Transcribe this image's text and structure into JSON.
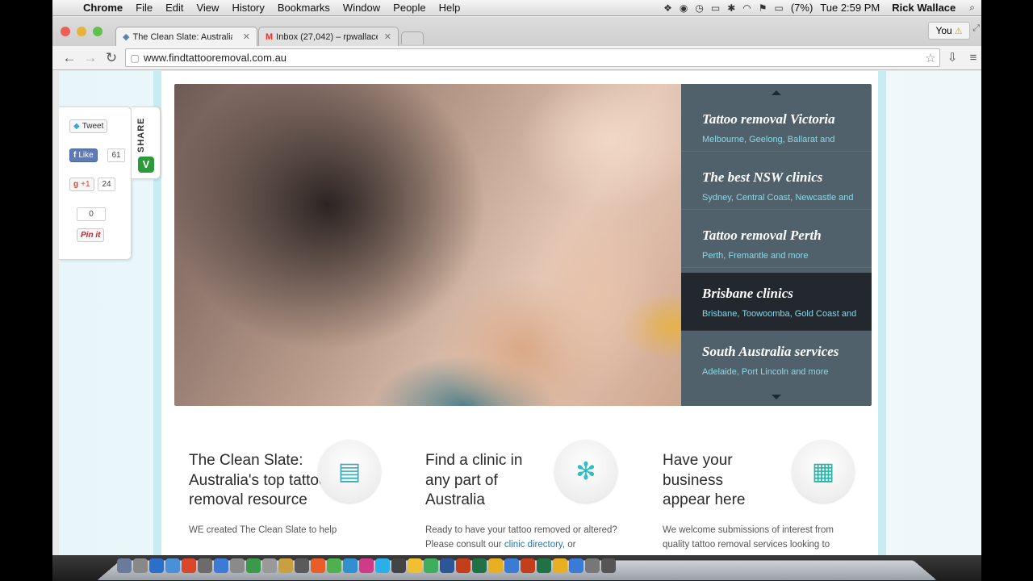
{
  "menubar": {
    "app": "Chrome",
    "menus": [
      "File",
      "Edit",
      "View",
      "History",
      "Bookmarks",
      "Window",
      "People",
      "Help"
    ],
    "battery": "(7%)",
    "clock": "Tue 2:59 PM",
    "user": "Rick Wallace"
  },
  "tabs": [
    {
      "title": "The Clean Slate: Australia'"
    },
    {
      "title": "Inbox (27,042) – rpwallace"
    }
  ],
  "profile_button": "You",
  "omnibox": {
    "url": "www.findtattooremoval.com.au"
  },
  "share": {
    "label": "SHARE",
    "logo": "V",
    "tweet": "Tweet",
    "like": "Like",
    "like_count": "61",
    "gplus": "+1",
    "gplus_count": "24",
    "pin_count": "0",
    "pin": "Pin it"
  },
  "hero_menu": [
    {
      "title": "Tattoo removal Victoria",
      "sub": "Melbourne, Geelong, Ballarat and"
    },
    {
      "title": "The best NSW clinics",
      "sub": "Sydney, Central Coast, Newcastle and"
    },
    {
      "title": "Tattoo removal Perth",
      "sub": "Perth, Fremantle and more"
    },
    {
      "title": "Brisbane clinics",
      "sub": "Brisbane, Toowoomba, Gold Coast and"
    },
    {
      "title": "South Australia services",
      "sub": "Adelaide, Port Lincoln and more"
    }
  ],
  "features": [
    {
      "title": "The Clean Slate: Australia's top tattoo removal resource",
      "body": "WE created The Clean Slate to help",
      "icon": "book-icon"
    },
    {
      "title": "Find a clinic in any part of Australia",
      "body": "Ready to have your tattoo removed or altered? Please consult our",
      "link": "clinic directory",
      "body_tail": ", or",
      "icon": "medical-icon"
    },
    {
      "title": "Have your business appear here",
      "body": "We welcome submissions of interest from quality tattoo removal services looking to",
      "icon": "calendar-icon"
    }
  ],
  "colors": {
    "hero_menu_bg": "#425460",
    "hero_menu_active": "#1e2428",
    "hero_sub_text": "#8ad8e8",
    "link": "#1a7ab8",
    "page_frame": "#c8ecf3"
  }
}
